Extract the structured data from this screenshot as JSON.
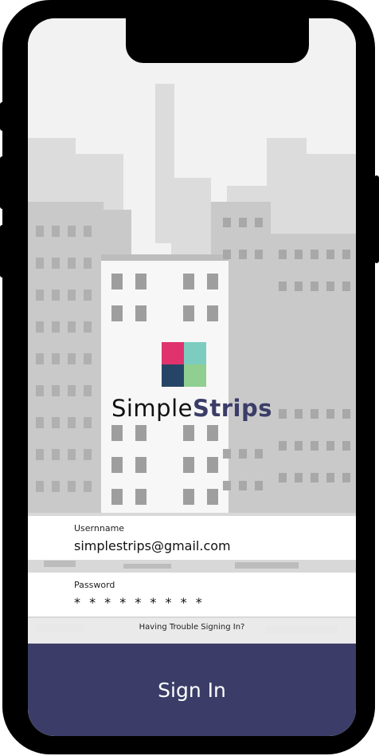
{
  "app": {
    "brand_first": "Simple",
    "brand_second": "Strips"
  },
  "logo": {
    "colors": [
      "#e0336e",
      "#7ccdbf",
      "#264566",
      "#8fcf90"
    ],
    "icon": "four-square-logo"
  },
  "form": {
    "username_label": "Usernname",
    "username_value": "simplestrips@gmail.com",
    "password_label": "Password",
    "password_value": "* * * * * * * * *",
    "trouble_text": "Having Trouble Signing In?",
    "sign_in_label": "Sign In"
  },
  "colors": {
    "brand_dark": "#3b3d68",
    "sign_in_bg": "#3b3d68",
    "phone_frame": "#000000"
  }
}
